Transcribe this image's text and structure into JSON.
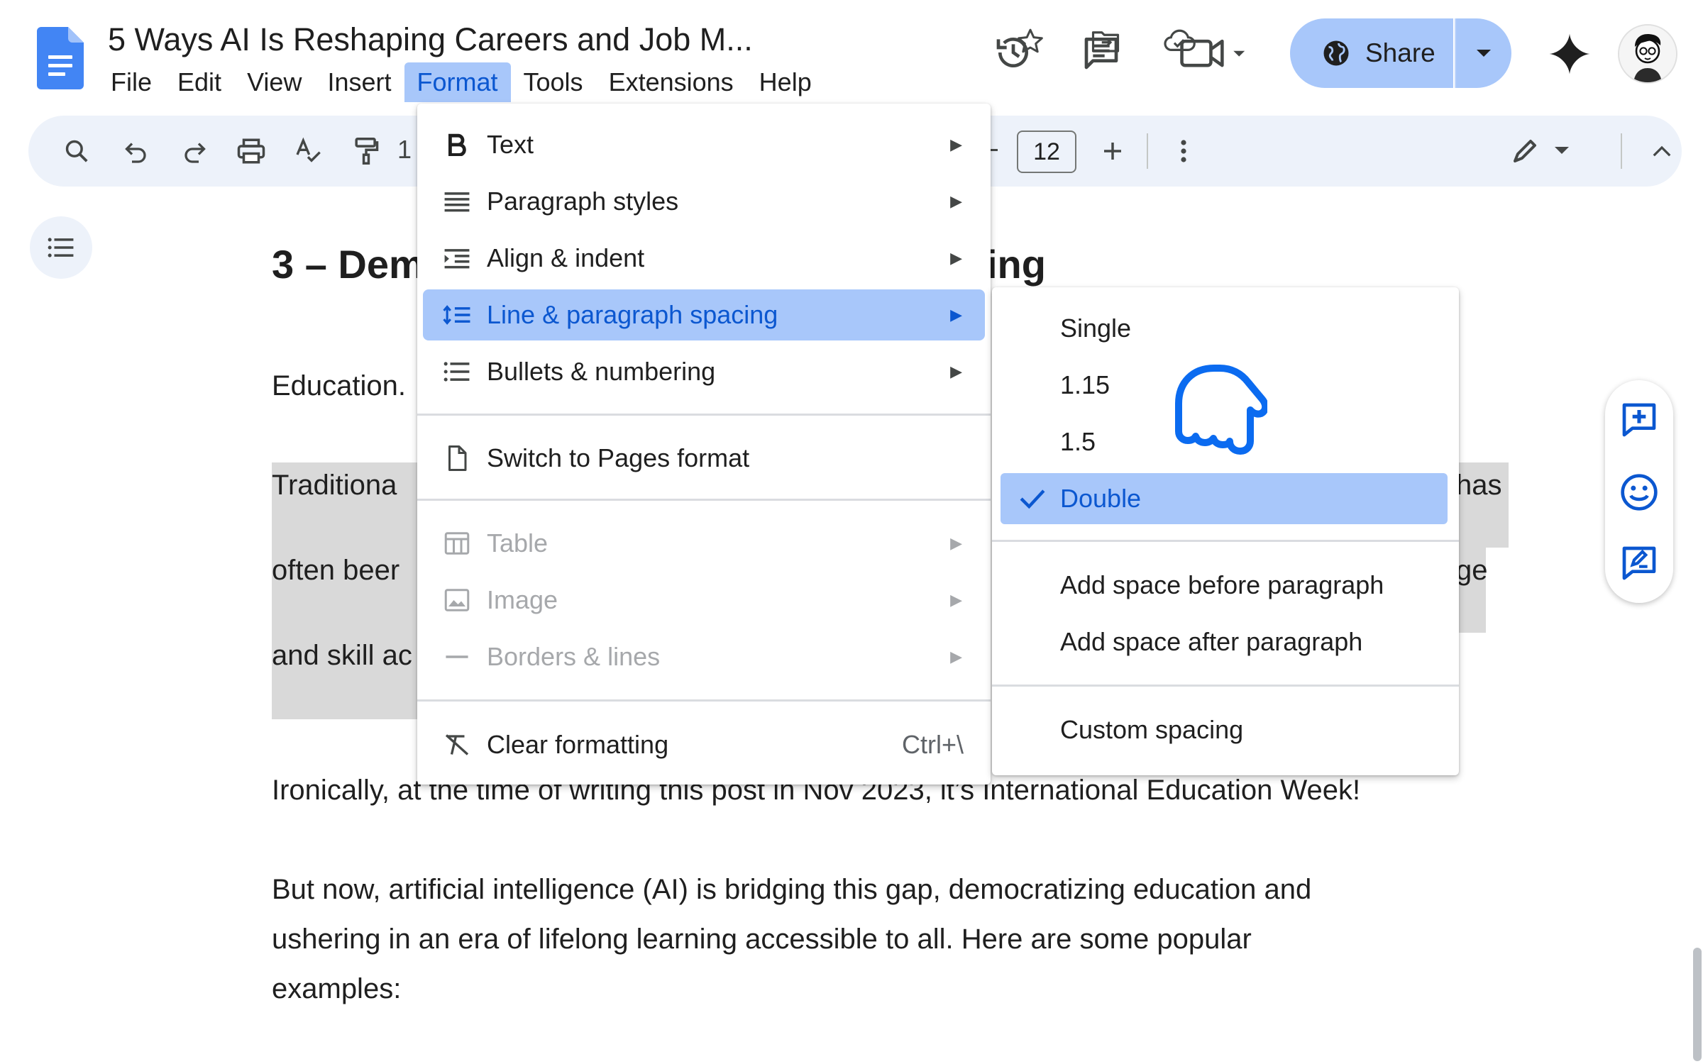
{
  "header": {
    "doc_title": "5 Ways AI Is Reshaping Careers and Job M...",
    "menus": [
      "File",
      "Edit",
      "View",
      "Insert",
      "Format",
      "Tools",
      "Extensions",
      "Help"
    ],
    "share_label": "Share"
  },
  "toolbar": {
    "font_size": "12",
    "partial_char": "1"
  },
  "document": {
    "heading_left": "3 – Dem",
    "heading_right": "ing",
    "para1": "Education.",
    "hl_line1": "Traditiona",
    "hl_line1_right": "has",
    "hl_line2": "often beer",
    "hl_line2_right": "ge",
    "hl_line3": "and skill ac",
    "para_ironic": "Ironically, at the time of writing this post in Nov 2023, it’s International Education Week!",
    "para_but_1": "But now, artificial intelligence (AI) is bridging this gap, democratizing education and",
    "para_but_2": "ushering in an era of lifelong learning accessible to all. Here are some popular",
    "para_but_3": "examples:"
  },
  "format_menu": {
    "items": [
      {
        "label": "Text",
        "icon": "bold-icon"
      },
      {
        "label": "Paragraph styles",
        "icon": "paragraph-styles-icon"
      },
      {
        "label": "Align & indent",
        "icon": "indent-icon"
      },
      {
        "label": "Line & paragraph spacing",
        "icon": "line-spacing-icon"
      },
      {
        "label": "Bullets & numbering",
        "icon": "bullets-icon"
      },
      {
        "label": "Switch to Pages format",
        "icon": "page-icon"
      },
      {
        "label": "Table",
        "icon": "table-icon"
      },
      {
        "label": "Image",
        "icon": "image-icon"
      },
      {
        "label": "Borders & lines",
        "icon": "border-line-icon"
      },
      {
        "label": "Clear formatting",
        "icon": "clear-format-icon",
        "shortcut": "Ctrl+\\"
      }
    ]
  },
  "spacing_submenu": {
    "items": [
      "Single",
      "1.15",
      "1.5",
      "Double",
      "Add space before paragraph",
      "Add space after paragraph",
      "Custom spacing"
    ],
    "selected": "Double"
  },
  "colors": {
    "accent": "#0b57d0",
    "highlight_blue": "#a8c7fa",
    "toolbar_bg": "#edf2fa"
  }
}
